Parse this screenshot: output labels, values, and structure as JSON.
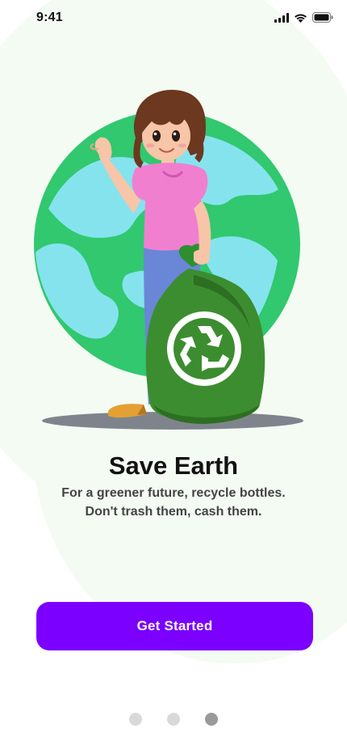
{
  "status_bar": {
    "time": "9:41",
    "icons": [
      "cellular-signal-icon",
      "wifi-icon",
      "battery-icon"
    ]
  },
  "illustration": {
    "subject": "girl holding recycling bag in front of globe",
    "icon": "recycle-icon"
  },
  "onboarding": {
    "title": "Save Earth",
    "subtitle_line1": "For a greener future, recycle bottles.",
    "subtitle_line2": "Don't trash them, cash them."
  },
  "actions": {
    "primary_label": "Get Started"
  },
  "pager": {
    "count": 3,
    "active_index": 2
  },
  "colors": {
    "accent": "#7b00ff",
    "button_text": "#ffffff",
    "title": "#121212",
    "subtitle": "#444444",
    "background_tint": "#f3fbf3",
    "dot_inactive": "#d9d9d9",
    "dot_active": "#9a9a9a"
  }
}
